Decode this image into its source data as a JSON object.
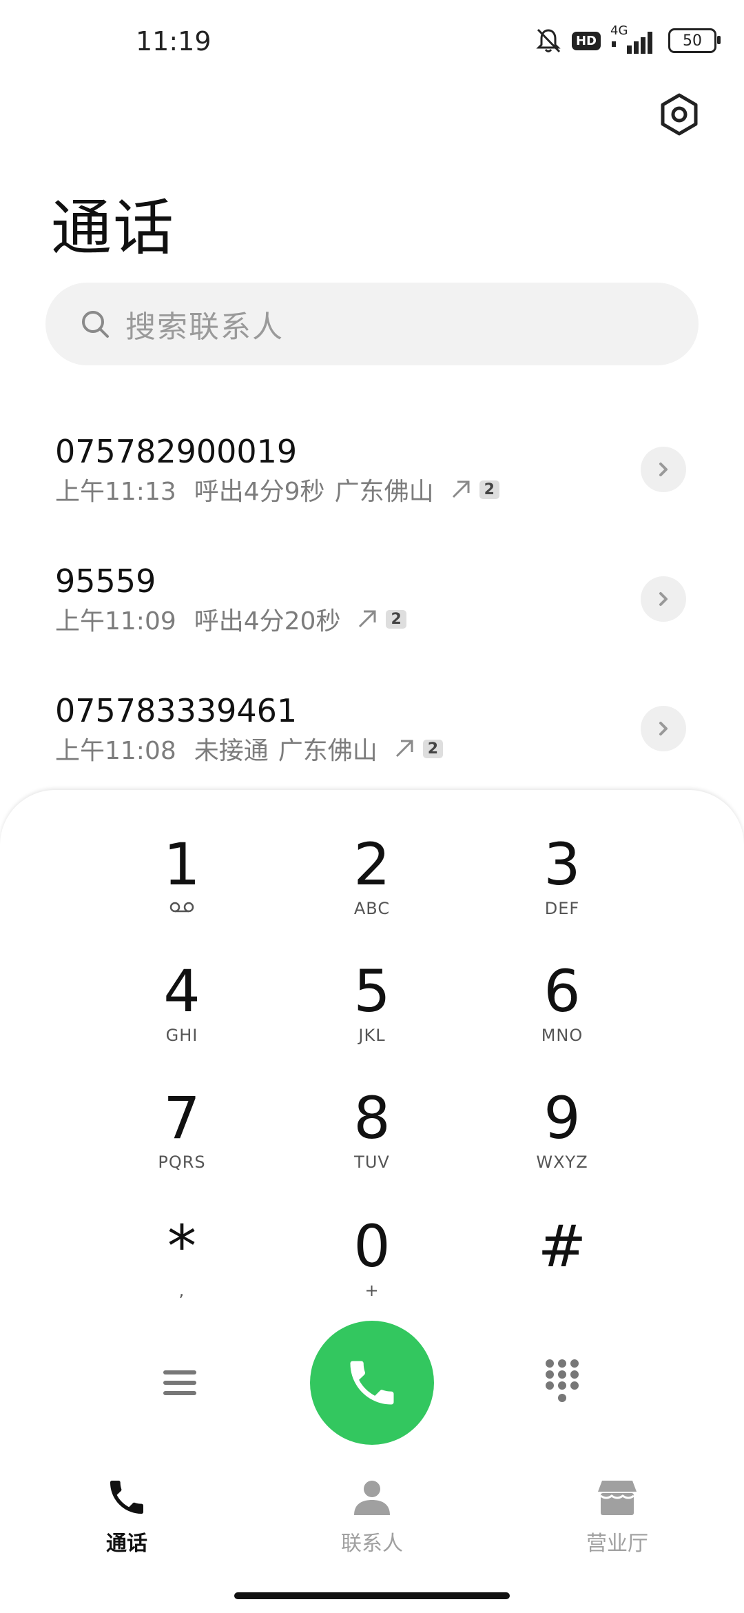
{
  "status_bar": {
    "time": "11:19",
    "hd": "HD",
    "network": "4G",
    "battery": "50"
  },
  "header": {
    "title": "通话",
    "settings_icon": "settings-hexagon-icon"
  },
  "search": {
    "placeholder": "搜索联系人"
  },
  "call_log": [
    {
      "number": "075782900019",
      "time": "上午11:13",
      "status": "呼出4分9秒",
      "location": "广东佛山",
      "count": "2"
    },
    {
      "number": "95559",
      "time": "上午11:09",
      "status": "呼出4分20秒",
      "location": "",
      "count": "2"
    },
    {
      "number": "075783339461",
      "time": "上午11:08",
      "status": "未接通",
      "location": "广东佛山",
      "count": "2"
    }
  ],
  "dialpad": {
    "keys": [
      {
        "digit": "1",
        "letters": ""
      },
      {
        "digit": "2",
        "letters": "ABC"
      },
      {
        "digit": "3",
        "letters": "DEF"
      },
      {
        "digit": "4",
        "letters": "GHI"
      },
      {
        "digit": "5",
        "letters": "JKL"
      },
      {
        "digit": "6",
        "letters": "MNO"
      },
      {
        "digit": "7",
        "letters": "PQRS"
      },
      {
        "digit": "8",
        "letters": "TUV"
      },
      {
        "digit": "9",
        "letters": "WXYZ"
      },
      {
        "digit": "*",
        "letters": ","
      },
      {
        "digit": "0",
        "letters": "+"
      },
      {
        "digit": "#",
        "letters": ""
      }
    ],
    "call_button_color": "#33c75f"
  },
  "bottom_nav": {
    "items": [
      {
        "label": "通话",
        "active": true
      },
      {
        "label": "联系人",
        "active": false
      },
      {
        "label": "营业厅",
        "active": false
      }
    ]
  }
}
